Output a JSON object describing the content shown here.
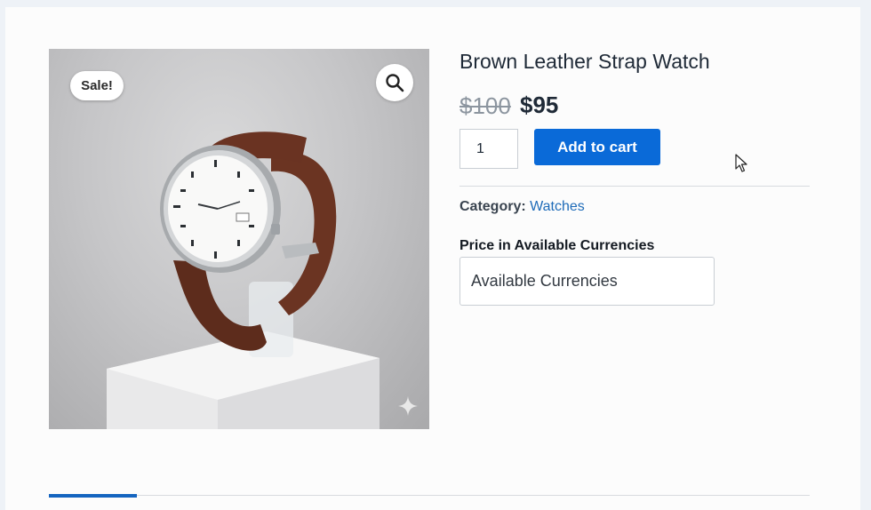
{
  "product": {
    "title": "Brown Leather Strap Watch",
    "price_regular": "$100",
    "price_sale": "$95",
    "sale_badge": "Sale!",
    "quantity": "1",
    "add_to_cart_label": "Add to cart",
    "category_label": "Category:",
    "category_value": "Watches"
  },
  "currency": {
    "heading": "Price in Available Currencies",
    "select_value": "Available Currencies"
  },
  "icons": {
    "zoom": "magnifier-icon",
    "sparkle": "sparkle-icon",
    "cursor": "mouse-pointer-icon"
  },
  "colors": {
    "accent": "#0a6ad8",
    "link": "#1e6bb8",
    "tab_active": "#1565c0"
  }
}
